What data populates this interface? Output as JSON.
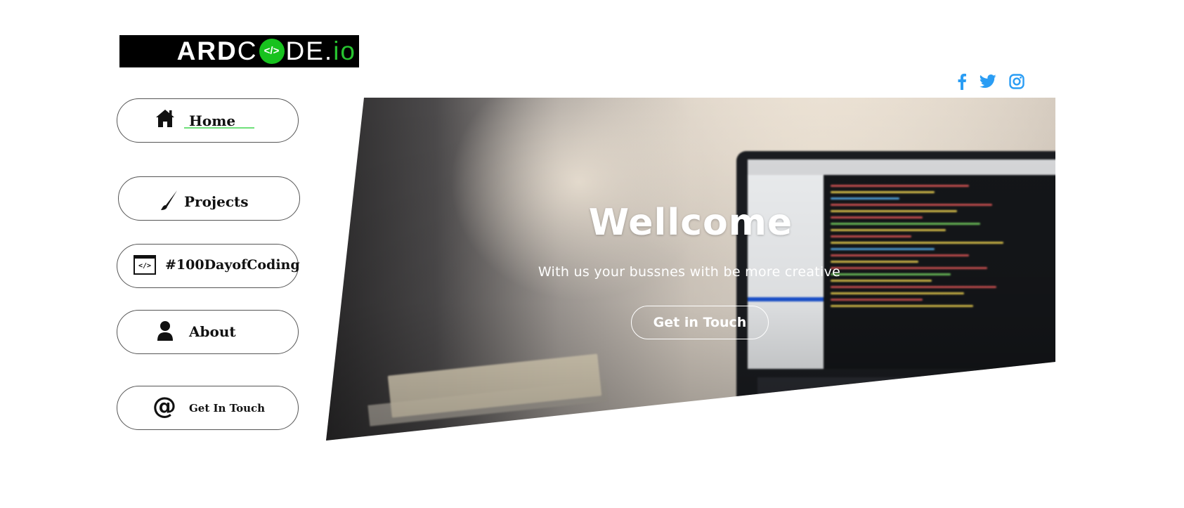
{
  "logo": {
    "part1": "ARD",
    "part2": "C",
    "badge": "</>",
    "part3": "DE",
    "dot": ".",
    "part4": "io"
  },
  "social": {
    "icons": [
      "facebook-icon",
      "twitter-icon",
      "instagram-icon"
    ],
    "color": "#2a9df4"
  },
  "nav": {
    "home": "Home",
    "projects": "Projects",
    "coding": "#100DayofCoding",
    "coding_icon_text": "</>",
    "about": "About",
    "contact": "Get In Touch",
    "contact_icon_text": "@"
  },
  "hero": {
    "title": "Wellcome",
    "subtitle": "With us your bussnes with be more creative",
    "cta": "Get in Touch"
  },
  "colors": {
    "accent": "#17c21e",
    "social": "#2a9df4"
  }
}
